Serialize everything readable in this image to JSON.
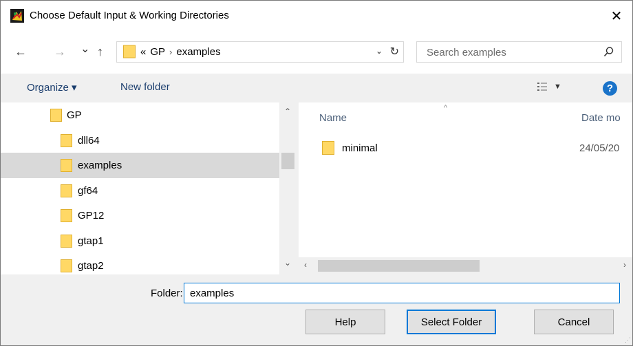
{
  "window": {
    "title": "Choose Default Input & Working Directories"
  },
  "nav": {
    "back": "←",
    "forward": "→",
    "recent": "⌄",
    "up": "↑"
  },
  "address": {
    "overflow": "«",
    "crumbs": [
      "GP",
      "examples"
    ],
    "separator": "›"
  },
  "search": {
    "placeholder": "Search examples"
  },
  "toolbar": {
    "organize": "Organize ▾",
    "new_folder": "New folder"
  },
  "tree": [
    {
      "label": "GP",
      "selected": false
    },
    {
      "label": "dll64",
      "selected": false
    },
    {
      "label": "examples",
      "selected": true
    },
    {
      "label": "gf64",
      "selected": false
    },
    {
      "label": "GP12",
      "selected": false
    },
    {
      "label": "gtap1",
      "selected": false
    },
    {
      "label": "gtap2",
      "selected": false
    }
  ],
  "columns": {
    "name": "Name",
    "date": "Date mo"
  },
  "files": [
    {
      "name": "minimal",
      "date": "24/05/20"
    }
  ],
  "folder_field": {
    "label": "Folder:",
    "value": "examples"
  },
  "buttons": {
    "help": "Help",
    "select": "Select Folder",
    "cancel": "Cancel"
  },
  "colors": {
    "accent": "#0078d7",
    "folder": "#ffd865",
    "help_icon": "#1a73c9"
  }
}
